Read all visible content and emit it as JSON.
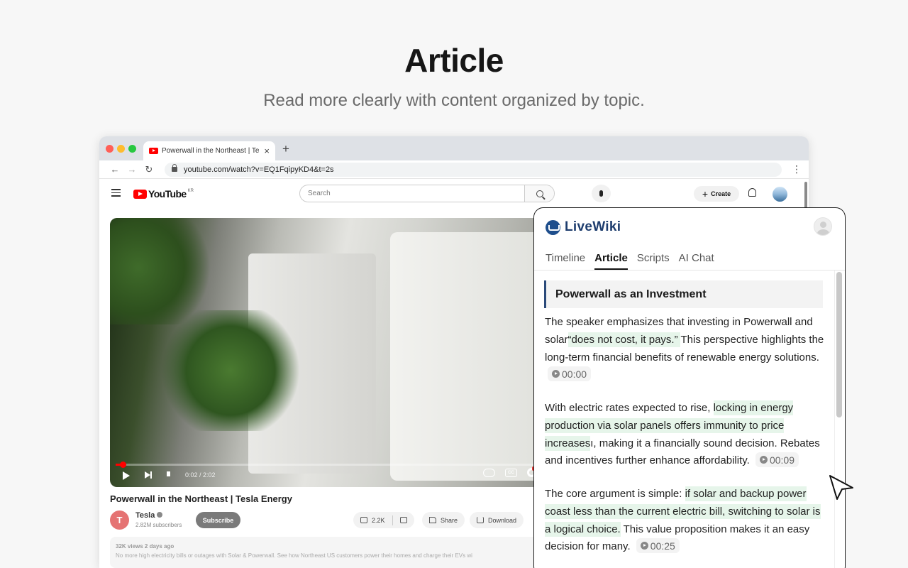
{
  "hero": {
    "title": "Article",
    "subtitle": "Read more clearly with content organized by topic."
  },
  "browser": {
    "tab_title": "Powerwall in the Northeast | Te",
    "url": "youtube.com/watch?v=EQ1FqipyKD4&t=2s"
  },
  "youtube": {
    "logo_text": "YouTube",
    "region": "KR",
    "search_placeholder": "Search",
    "create_label": "Create",
    "player_time": "0:02 / 2:02",
    "playback_progress": 0.016,
    "cc_label": "CC",
    "video_title": "Powerwall in the Northeast | Tesla Energy",
    "channel_name": "Tesla",
    "channel_subs": "2.82M subscribers",
    "subscribe_label": "Subscribe",
    "likes": "2.2K",
    "share_label": "Share",
    "download_label": "Download",
    "meta": "32K views  2 days ago",
    "description": "No more high electricity bills or outages with Solar & Powerwall. See how Northeast US customers power their homes and charge their EVs wi"
  },
  "livewiki": {
    "brand": "LiveWiki",
    "tabs": [
      "Timeline",
      "Article",
      "Scripts",
      "AI Chat"
    ],
    "active_tab": "Article",
    "section_title": "Powerwall as an Investment",
    "paragraphs": [
      {
        "pre": "The speaker emphasizes that investing in Powerwall and solar",
        "highlight": "“does not cost, it pays.” ",
        "post": " This perspective highlights the long-term financial benefits of renewable energy solutions.",
        "timestamp": "00:00"
      },
      {
        "pre": "With electric rates expected to rise, ",
        "highlight": "locking in energy production via solar panels offers immunity to price increases",
        "post": "ı, making it a financially sound decision. Rebates and incentives further enhance affordability.",
        "timestamp": "00:09"
      },
      {
        "pre": "The core argument is simple: ",
        "highlight": "if solar and backup power coast less than the current electric bill, switching to solar is a logical choice.",
        "post": " This value proposition makes it an easy decision for many.",
        "timestamp": "00:25"
      }
    ]
  },
  "colors": {
    "youtube_red": "#ff0000",
    "livewiki_blue": "#1e3d6e",
    "highlight_green": "#e6f5ea"
  }
}
